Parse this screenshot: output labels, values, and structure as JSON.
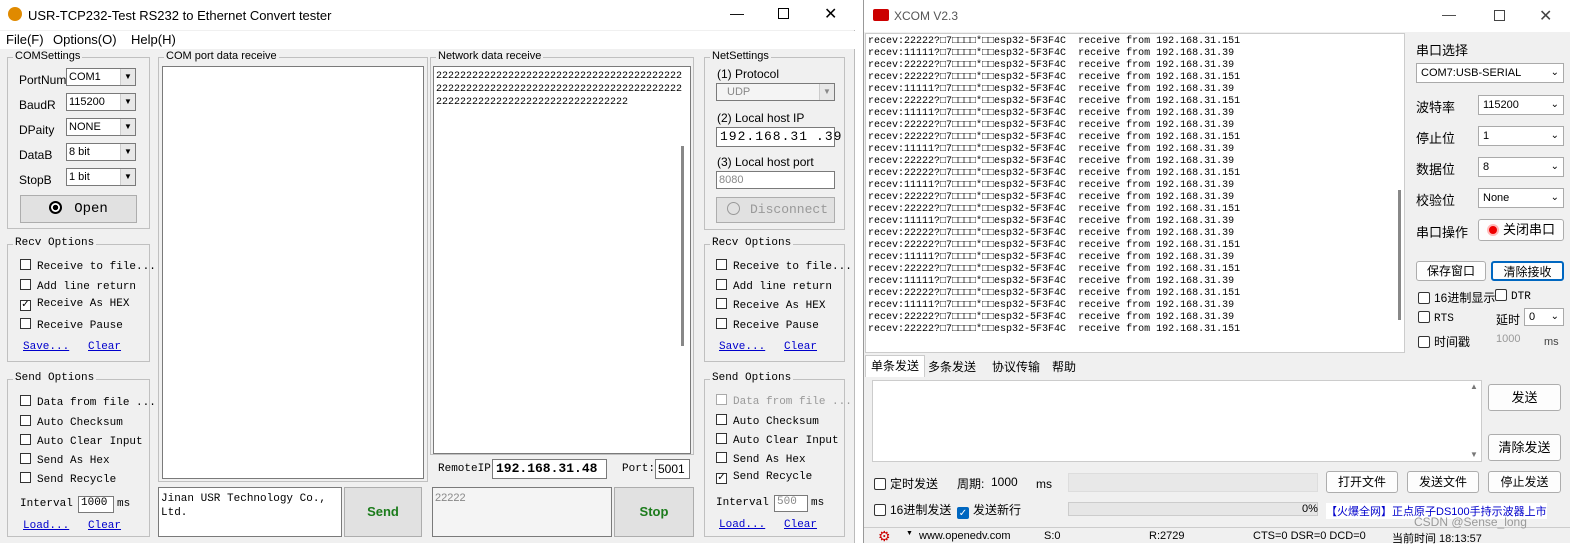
{
  "usr": {
    "title": "USR-TCP232-Test  RS232 to Ethernet Convert tester",
    "menu": [
      "File(F)",
      "Options(O)",
      "Help(H)"
    ],
    "com_settings": {
      "legend": "COMSettings",
      "port_label": "PortNum",
      "port_value": "COM1",
      "baud_label": "BaudR",
      "baud_value": "115200",
      "parity_label": "DPaity",
      "parity_value": "NONE",
      "data_label": "DataB",
      "data_value": "8 bit",
      "stop_label": "StopB",
      "stop_value": "1 bit",
      "open_label": "Open"
    },
    "com_receive_legend": "COM port data receive",
    "net_receive_legend": "Network data receive",
    "net_receive_text": "222222222222222222222222222222222222222222222222222222222222222222222222222222222222222222222222222222222222222222",
    "net_settings": {
      "legend": "NetSettings",
      "protocol_label": "(1) Protocol",
      "protocol_value": "UDP",
      "local_ip_label": "(2) Local host IP",
      "local_ip_a": "192.168.31",
      "local_ip_b": ".39",
      "local_port_label": "(3) Local host port",
      "local_port_value": "8080",
      "disconnect_label": "Disconnect"
    },
    "recv_options": {
      "legend": "Recv Options",
      "items": [
        "Receive to file...",
        "Add line return",
        "Receive As HEX",
        "Receive Pause"
      ],
      "save": "Save...",
      "clear": "Clear"
    },
    "send_options": {
      "legend": "Send Options",
      "items": [
        "Data from file ...",
        "Auto Checksum",
        "Auto Clear Input",
        "Send As Hex",
        "Send Recycle"
      ],
      "interval_label": "Interval",
      "interval_value": "1000",
      "interval_unit": "ms",
      "load": "Load...",
      "clear": "Clear"
    },
    "recv_options_r": {
      "legend": "Recv Options",
      "items": [
        "Receive to file...",
        "Add line return",
        "Receive As HEX",
        "Receive Pause"
      ],
      "save": "Save...",
      "clear": "Clear"
    },
    "send_options_r": {
      "legend": "Send Options",
      "items": [
        "Data from file ...",
        "Auto Checksum",
        "Auto Clear Input",
        "Send As Hex",
        "Send Recycle"
      ],
      "interval_label": "Interval",
      "interval_value": "500",
      "interval_unit": "ms",
      "load": "Load...",
      "clear": "Clear"
    },
    "remote_ip_label": "RemoteIP:",
    "remote_ip_value": "192.168.31.48",
    "port_label": "Port:",
    "port_value": "5001",
    "com_send_text": "Jinan USR Technology Co., Ltd.",
    "send_label": "Send",
    "net_send_text": "22222",
    "stop_label": "Stop"
  },
  "xcom": {
    "title": "XCOM V2.3",
    "lines": [
      {
        "a": "recev:22222?□7□□□□*□□esp32-5F3F4C",
        "b": "receive from 192.168.31.151"
      },
      {
        "a": "recev:11111?□7□□□□*□□esp32-5F3F4C",
        "b": "receive from 192.168.31.39"
      },
      {
        "a": "recev:22222?□7□□□□*□□esp32-5F3F4C",
        "b": "receive from 192.168.31.39"
      },
      {
        "a": "recev:22222?□7□□□□*□□esp32-5F3F4C",
        "b": "receive from 192.168.31.151"
      },
      {
        "a": "recev:11111?□7□□□□*□□esp32-5F3F4C",
        "b": "receive from 192.168.31.39"
      },
      {
        "a": "recev:22222?□7□□□□*□□esp32-5F3F4C",
        "b": "receive from 192.168.31.151"
      },
      {
        "a": "recev:11111?□7□□□□*□□esp32-5F3F4C",
        "b": "receive from 192.168.31.39"
      },
      {
        "a": "recev:22222?□7□□□□*□□esp32-5F3F4C",
        "b": "receive from 192.168.31.39"
      },
      {
        "a": "recev:22222?□7□□□□*□□esp32-5F3F4C",
        "b": "receive from 192.168.31.151"
      },
      {
        "a": "recev:11111?□7□□□□*□□esp32-5F3F4C",
        "b": "receive from 192.168.31.39"
      },
      {
        "a": "recev:22222?□7□□□□*□□esp32-5F3F4C",
        "b": "receive from 192.168.31.39"
      },
      {
        "a": "recev:22222?□7□□□□*□□esp32-5F3F4C",
        "b": "receive from 192.168.31.151"
      },
      {
        "a": "recev:11111?□7□□□□*□□esp32-5F3F4C",
        "b": "receive from 192.168.31.39"
      },
      {
        "a": "recev:22222?□7□□□□*□□esp32-5F3F4C",
        "b": "receive from 192.168.31.39"
      },
      {
        "a": "recev:22222?□7□□□□*□□esp32-5F3F4C",
        "b": "receive from 192.168.31.151"
      },
      {
        "a": "recev:11111?□7□□□□*□□esp32-5F3F4C",
        "b": "receive from 192.168.31.39"
      },
      {
        "a": "recev:22222?□7□□□□*□□esp32-5F3F4C",
        "b": "receive from 192.168.31.39"
      },
      {
        "a": "recev:22222?□7□□□□*□□esp32-5F3F4C",
        "b": "receive from 192.168.31.151"
      },
      {
        "a": "recev:11111?□7□□□□*□□esp32-5F3F4C",
        "b": "receive from 192.168.31.39"
      },
      {
        "a": "recev:22222?□7□□□□*□□esp32-5F3F4C",
        "b": "receive from 192.168.31.151"
      },
      {
        "a": "recev:11111?□7□□□□*□□esp32-5F3F4C",
        "b": "receive from 192.168.31.39"
      },
      {
        "a": "recev:22222?□7□□□□*□□esp32-5F3F4C",
        "b": "receive from 192.168.31.151"
      },
      {
        "a": "recev:11111?□7□□□□*□□esp32-5F3F4C",
        "b": "receive from 192.168.31.39"
      },
      {
        "a": "recev:22222?□7□□□□*□□esp32-5F3F4C",
        "b": "receive from 192.168.31.39"
      },
      {
        "a": "recev:22222?□7□□□□*□□esp32-5F3F4C",
        "b": "receive from 192.168.31.151"
      }
    ],
    "side": {
      "port_select": "串口选择",
      "port_value": "COM7:USB-SERIAL",
      "baud": "波特率",
      "baud_value": "115200",
      "stop": "停止位",
      "stop_value": "1",
      "data": "数据位",
      "data_value": "8",
      "parity": "校验位",
      "parity_value": "None",
      "op": "串口操作",
      "close_btn": "关闭串口",
      "save_win": "保存窗口",
      "clear_recv": "清除接收",
      "hex_show": "16进制显示",
      "dtr": "DTR",
      "rts": "RTS",
      "delay": "延时",
      "delay_value": "0",
      "timestamp": "时间戳",
      "ts_value": "1000",
      "ts_unit": "ms"
    },
    "tabs": [
      "单条发送",
      "多条发送",
      "协议传输",
      "帮助"
    ],
    "send_btn": "发送",
    "clear_send": "清除发送",
    "timed_send": "定时发送",
    "period_label": "周期:",
    "period_value": "1000",
    "period_unit": "ms",
    "open_file": "打开文件",
    "send_file": "发送文件",
    "stop_send": "停止发送",
    "hex_send": "16进制发送",
    "newline_send": "发送新行",
    "progress_pct": "0%",
    "ad": "【火爆全网】正点原子DS100手持示波器上市",
    "status": {
      "url": "www.openedv.com",
      "s": "S:0",
      "r": "R:2729",
      "cts": "CTS=0 DSR=0 DCD=0",
      "time": "当前时间 18:13:57"
    },
    "watermark": "CSDN @Sense_long"
  }
}
